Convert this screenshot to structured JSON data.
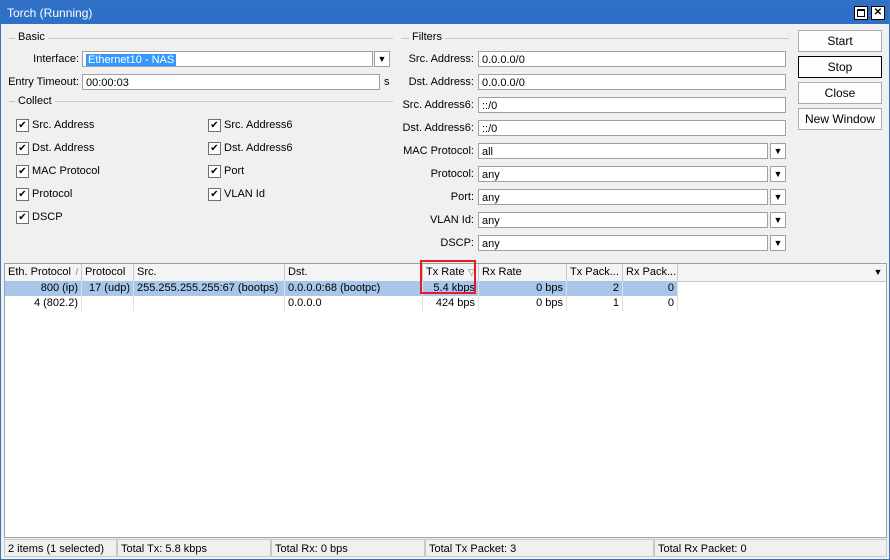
{
  "window": {
    "title": "Torch (Running)"
  },
  "basic": {
    "label": "Basic",
    "interface_label": "Interface:",
    "interface_value": "Ethernet10 - NAS",
    "entry_timeout_label": "Entry Timeout:",
    "entry_timeout_value": "00:00:03",
    "entry_timeout_unit": "s"
  },
  "collect": {
    "label": "Collect",
    "items": [
      {
        "label": "Src. Address",
        "checked": true
      },
      {
        "label": "Dst. Address",
        "checked": true
      },
      {
        "label": "MAC Protocol",
        "checked": true
      },
      {
        "label": "Protocol",
        "checked": true
      },
      {
        "label": "DSCP",
        "checked": true
      },
      {
        "label": "Src. Address6",
        "checked": true
      },
      {
        "label": "Dst. Address6",
        "checked": true
      },
      {
        "label": "Port",
        "checked": true
      },
      {
        "label": "VLAN Id",
        "checked": true
      }
    ]
  },
  "filters": {
    "label": "Filters",
    "src_address": {
      "label": "Src. Address:",
      "value": "0.0.0.0/0"
    },
    "dst_address": {
      "label": "Dst. Address:",
      "value": "0.0.0.0/0"
    },
    "src_address6": {
      "label": "Src. Address6:",
      "value": "::/0"
    },
    "dst_address6": {
      "label": "Dst. Address6:",
      "value": "::/0"
    },
    "mac_protocol": {
      "label": "MAC Protocol:",
      "value": "all"
    },
    "protocol": {
      "label": "Protocol:",
      "value": "any"
    },
    "port": {
      "label": "Port:",
      "value": "any"
    },
    "vlan_id": {
      "label": "VLAN Id:",
      "value": "any"
    },
    "dscp": {
      "label": "DSCP:",
      "value": "any"
    }
  },
  "buttons": {
    "start": "Start",
    "stop": "Stop",
    "close": "Close",
    "new_window": "New Window"
  },
  "table": {
    "columns": [
      "Eth. Protocol",
      "Protocol",
      "Src.",
      "Dst.",
      "Tx Rate",
      "Rx Rate",
      "Tx Pack...",
      "Rx Pack..."
    ],
    "rows": [
      {
        "eth_protocol": "800 (ip)",
        "protocol": "17 (udp)",
        "src": "255.255.255.255:67 (bootps)",
        "dst": "0.0.0.0:68 (bootpc)",
        "tx_rate": "5.4 kbps",
        "rx_rate": "0 bps",
        "tx_packets": "2",
        "rx_packets": "0"
      },
      {
        "eth_protocol": "4 (802.2)",
        "protocol": "",
        "src": "",
        "dst": "0.0.0.0",
        "tx_rate": "424 bps",
        "rx_rate": "0 bps",
        "tx_packets": "1",
        "rx_packets": "0"
      }
    ]
  },
  "status": {
    "items": "2 items (1 selected)",
    "total_tx": "Total Tx: 5.8 kbps",
    "total_rx": "Total Rx: 0 bps",
    "total_tx_packet": "Total Tx Packet: 3",
    "total_rx_packet": "Total Rx Packet: 0"
  },
  "icons": {
    "checkbox": "checkmark-icon",
    "dropdown": "dropdown-arrow-icon"
  }
}
